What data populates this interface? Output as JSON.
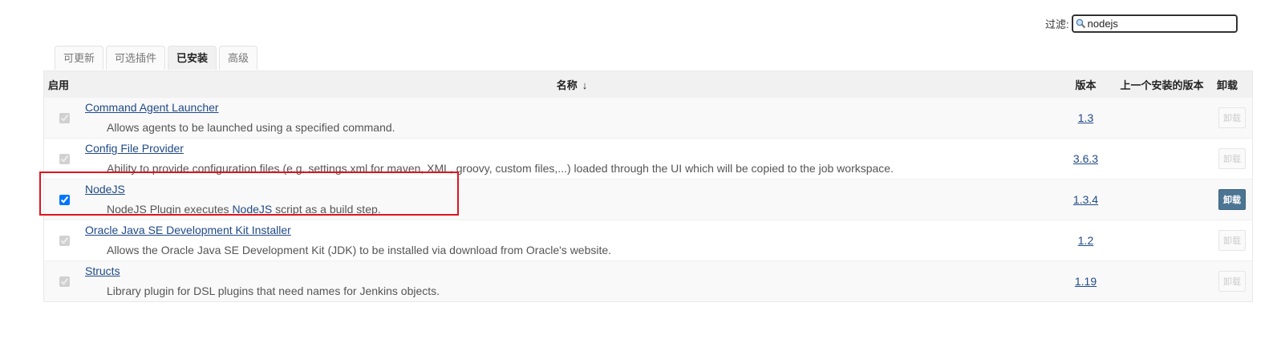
{
  "filter": {
    "label": "过滤:",
    "value": "nodejs"
  },
  "tabs": [
    {
      "label": "可更新"
    },
    {
      "label": "可选插件"
    },
    {
      "label": "已安装"
    },
    {
      "label": "高级"
    }
  ],
  "active_tab": "已安装",
  "table": {
    "headers": {
      "enable": "启用",
      "name": "名称",
      "sort_indicator": "↓",
      "version": "版本",
      "previous_version": "上一个安装的版本",
      "uninstall": "卸载"
    },
    "rows": [
      {
        "name": "Command Agent Launcher",
        "description": "Allows agents to be launched using a specified command.",
        "version": "1.3",
        "enabled": true,
        "uninstall_label": "卸载"
      },
      {
        "name": "Config File Provider",
        "description": "Ability to provide configuration files (e.g. settings.xml for maven, XML, groovy, custom files,...) loaded through the UI which will be copied to the job workspace.",
        "version": "3.6.3",
        "enabled": true,
        "uninstall_label": "卸载"
      },
      {
        "name": "NodeJS",
        "description_pre": "NodeJS Plugin executes ",
        "description_link": "NodeJS",
        "description_post": " script as a build step.",
        "version": "1.3.4",
        "enabled": true,
        "uninstall_label": "卸载"
      },
      {
        "name": "Oracle Java SE Development Kit Installer",
        "description": "Allows the Oracle Java SE Development Kit (JDK) to be installed via download from Oracle's website.",
        "version": "1.2",
        "enabled": true,
        "uninstall_label": "卸载"
      },
      {
        "name": "Structs",
        "description": "Library plugin for DSL plugins that need names for Jenkins objects.",
        "version": "1.19",
        "enabled": true,
        "uninstall_label": "卸载"
      }
    ]
  },
  "colors": {
    "link": "#204a87",
    "highlight": "#e0141e",
    "uninstall_active": "#4c7593"
  }
}
